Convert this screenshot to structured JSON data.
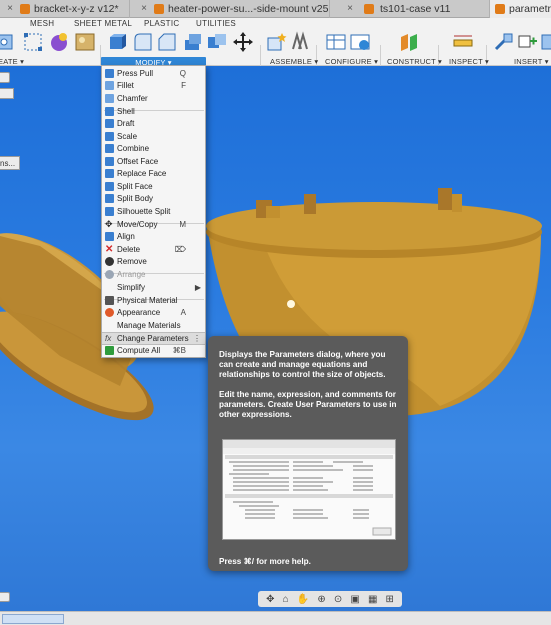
{
  "tabs": [
    {
      "label": "bracket-x-y-z v12*",
      "active": false
    },
    {
      "label": "heater-power-su...-side-mount v25",
      "active": false
    },
    {
      "label": "ts101-case v11",
      "active": false
    },
    {
      "label": "parametric",
      "active": true
    }
  ],
  "workspace_tabs": [
    "MESH",
    "SHEET METAL",
    "PLASTIC",
    "UTILITIES"
  ],
  "toolbar_groups": {
    "create": "EATE ▾",
    "modify": "MODIFY ▾",
    "assemble": "ASSEMBLE ▾",
    "configure": "CONFIGURE ▾",
    "construct": "CONSTRUCT ▾",
    "inspect": "INSPECT ▾",
    "insert": "INSERT ▾"
  },
  "modify_menu": [
    {
      "label": "Press Pull",
      "shortcut": "Q",
      "icon": "press-pull",
      "color": "#3a7fd0"
    },
    {
      "label": "Fillet",
      "shortcut": "F",
      "icon": "fillet",
      "color": "#6ea3e0"
    },
    {
      "label": "Chamfer",
      "shortcut": "",
      "icon": "chamfer",
      "color": "#6ea3e0"
    },
    {
      "label": "Shell",
      "shortcut": "",
      "icon": "shell",
      "color": "#3a7fd0"
    },
    {
      "label": "Draft",
      "shortcut": "",
      "icon": "draft",
      "color": "#3a7fd0"
    },
    {
      "label": "Scale",
      "shortcut": "",
      "icon": "scale",
      "color": "#3a7fd0"
    },
    {
      "label": "Combine",
      "shortcut": "",
      "icon": "combine",
      "color": "#3a7fd0"
    },
    {
      "label": "Offset Face",
      "shortcut": "",
      "icon": "offset-face",
      "color": "#3a7fd0"
    },
    {
      "label": "Replace Face",
      "shortcut": "",
      "icon": "replace-face",
      "color": "#3a7fd0"
    },
    {
      "label": "Split Face",
      "shortcut": "",
      "icon": "split-face",
      "color": "#3a7fd0"
    },
    {
      "label": "Split Body",
      "shortcut": "",
      "icon": "split-body",
      "color": "#3a7fd0"
    },
    {
      "label": "Silhouette Split",
      "shortcut": "",
      "icon": "silhouette-split",
      "color": "#3a7fd0"
    },
    {
      "label": "Move/Copy",
      "shortcut": "M",
      "icon": "move",
      "color": "#222222"
    },
    {
      "label": "Align",
      "shortcut": "",
      "icon": "align",
      "color": "#3a7fd0"
    },
    {
      "label": "Delete",
      "shortcut": "⌦",
      "icon": "delete",
      "color": "#d22a2a"
    },
    {
      "label": "Remove",
      "shortcut": "",
      "icon": "remove",
      "color": "#333333"
    },
    {
      "label": "Arrange",
      "shortcut": "",
      "icon": "arrange",
      "color": "#9aa6b5"
    },
    {
      "label": "Simplify",
      "shortcut": "▶",
      "icon": "",
      "color": ""
    },
    {
      "label": "Physical Material",
      "shortcut": "",
      "icon": "physical-material",
      "color": "#555555"
    },
    {
      "label": "Appearance",
      "shortcut": "A",
      "icon": "appearance",
      "color": "#e05a2a"
    },
    {
      "label": "Manage Materials",
      "shortcut": "",
      "icon": "",
      "color": ""
    },
    {
      "label": "Change Parameters",
      "shortcut": "⋮",
      "icon": "fx",
      "color": "#444444"
    },
    {
      "label": "Compute All",
      "shortcut": "⌘B",
      "icon": "compute-all",
      "color": "#2e9b3c"
    }
  ],
  "tooltip": {
    "para1": "Displays the Parameters dialog, where you can create and manage equations and relationships to control the size of objects.",
    "para2": "Edit the name, expression, and comments for parameters. Create User Parameters to use in other expressions.",
    "help": "Press ⌘/ for more help."
  },
  "left_stub_label": "ns..."
}
